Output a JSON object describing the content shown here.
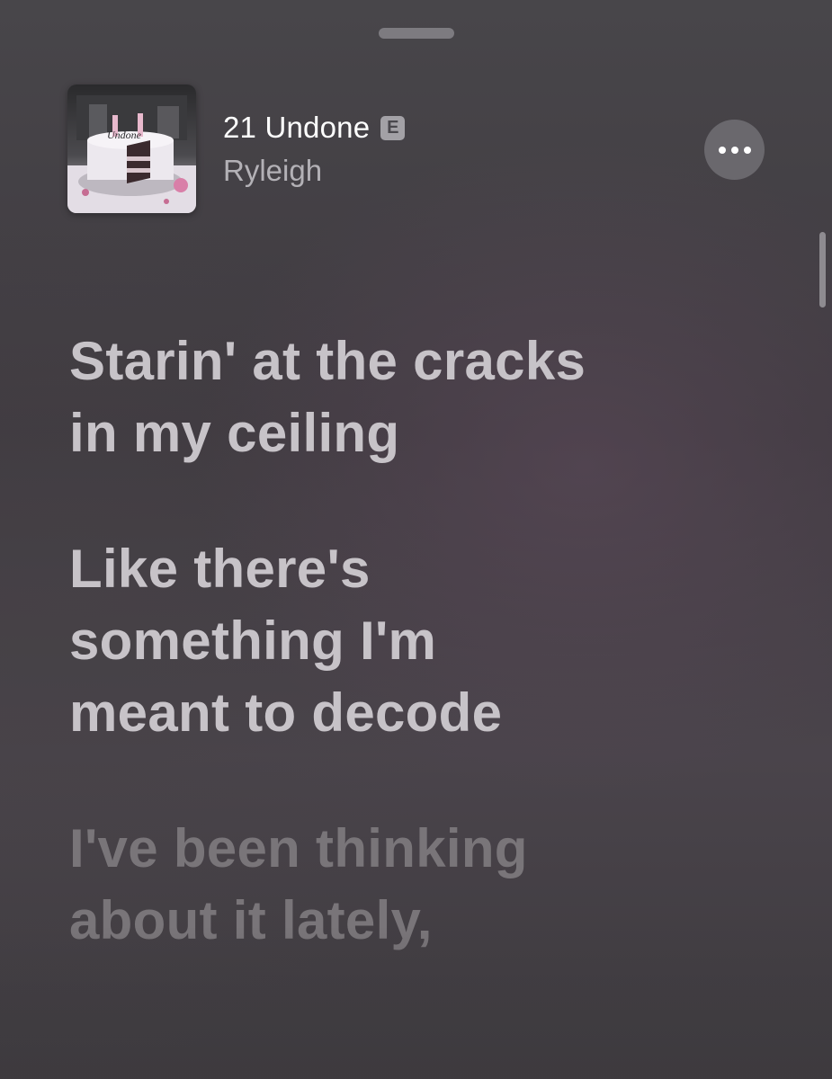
{
  "now_playing": {
    "title": "21 Undone",
    "explicit_badge": "E",
    "artist": "Ryleigh",
    "more_button_icon": "ellipsis-icon",
    "artwork_text": "Undone"
  },
  "lyrics": [
    {
      "text": "Starin' at the cracks\nin my ceiling",
      "state": "upcoming"
    },
    {
      "text": "Like there's\nsomething I'm\nmeant to decode",
      "state": "upcoming"
    },
    {
      "text": "I've been thinking\nabout it lately,",
      "state": "dimmed"
    }
  ],
  "colors": {
    "lyric_text": "#c7c3c8",
    "lyric_dimmed": "#797579",
    "title_text": "#ffffff",
    "artist_text": "#b3b1b6"
  }
}
